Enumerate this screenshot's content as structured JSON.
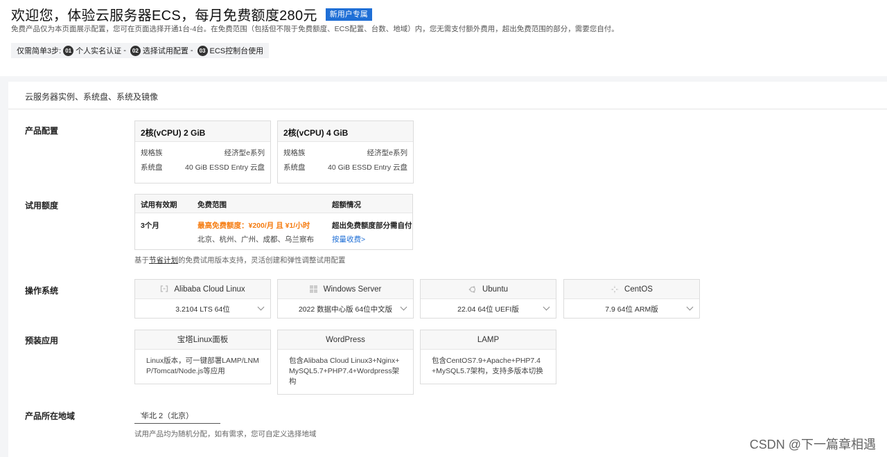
{
  "header": {
    "title": "欢迎您，体验云服务器ECS，每月免费额度280元",
    "badge": "新用户专属",
    "description": "免费产品仅为本页面展示配置，您可在页面选择开通1台-4台。在免费范围（包括但不限于免费额度、ECS配置、台数、地域）内，您无需支付额外费用，超出免费范围的部分，需要您自付。",
    "steps_label": "仅需简单3步:",
    "steps": [
      {
        "num": "01",
        "text": "个人实名认证"
      },
      {
        "num": "02",
        "text": "选择试用配置"
      },
      {
        "num": "03",
        "text": "ECS控制台使用"
      }
    ],
    "step_sep": "-"
  },
  "panel": {
    "heading": "云服务器实例、系统盘、系统及镜像",
    "config": {
      "label": "产品配置",
      "cards": [
        {
          "title": "2核(vCPU) 2 GiB",
          "rows": [
            {
              "k": "规格族",
              "v": "经济型e系列"
            },
            {
              "k": "系统盘",
              "v": "40 GiB ESSD Entry 云盘"
            }
          ]
        },
        {
          "title": "2核(vCPU) 4 GiB",
          "rows": [
            {
              "k": "规格族",
              "v": "经济型e系列"
            },
            {
              "k": "系统盘",
              "v": "40 GiB ESSD Entry 云盘"
            }
          ]
        }
      ]
    },
    "quota": {
      "label": "试用额度",
      "headers": [
        "试用有效期",
        "免费范围",
        "超额情况"
      ],
      "period": "3个月",
      "free_highlight": "最高免费额度：¥200/月 且 ¥1/小时",
      "free_regions": "北京、杭州、广州、成都、乌兰察布",
      "over_text": "超出免费额度部分需自付",
      "over_link": "按量收费>",
      "note_prefix": "基于",
      "note_link": "节省计划",
      "note_suffix": "的免费试用版本支持，灵活创建和弹性调整试用配置"
    },
    "os": {
      "label": "操作系统",
      "options": [
        {
          "name": "Alibaba Cloud Linux",
          "icon": "alibaba-cloud-icon",
          "version": "3.2104 LTS 64位"
        },
        {
          "name": "Windows Server",
          "icon": "windows-icon",
          "version": "2022 数据中心版 64位中文版"
        },
        {
          "name": "Ubuntu",
          "icon": "ubuntu-icon",
          "version": "22.04 64位 UEFI版"
        },
        {
          "name": "CentOS",
          "icon": "centos-icon",
          "version": "7.9 64位 ARM版"
        }
      ]
    },
    "apps": {
      "label": "预装应用",
      "options": [
        {
          "name": "宝塔Linux面板",
          "desc": "Linux版本，可一键部署LAMP/LNMP/Tomcat/Node.js等应用"
        },
        {
          "name": "WordPress",
          "desc": "包含Alibaba Cloud Linux3+Nginx+MySQL5.7+PHP7.4+Wordpress架构"
        },
        {
          "name": "LAMP",
          "desc": "包含CentOS7.9+Apache+PHP7.4+MySQL5.7架构，支持多版本切换"
        }
      ]
    },
    "region": {
      "label": "产品所在地域",
      "value": "华北 2（北京）",
      "note": "试用产品均为随机分配，如有需求，您可自定义选择地域"
    }
  },
  "watermark": "CSDN @下一篇章相遇",
  "colors": {
    "accent": "#1f6fd6",
    "highlight": "#f57b0f"
  }
}
